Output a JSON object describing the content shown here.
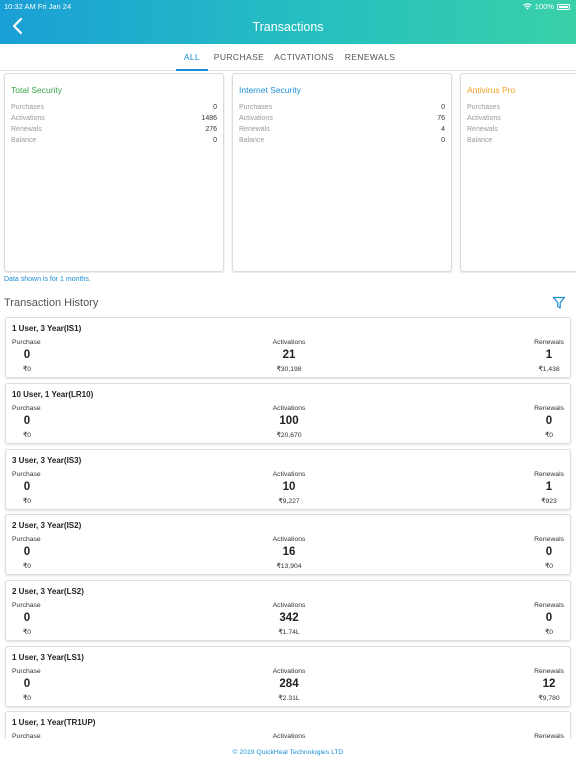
{
  "status": {
    "time": "10:32 AM   Fri Jan 24",
    "battery": "100%"
  },
  "header": {
    "title": "Transactions"
  },
  "tabs": [
    {
      "label": "ALL",
      "active": true
    },
    {
      "label": "PURCHASE",
      "active": false
    },
    {
      "label": "ACTIVATIONS",
      "active": false
    },
    {
      "label": "RENEWALS",
      "active": false
    }
  ],
  "summary_cards": [
    {
      "title": "Total Security",
      "title_color": "#3aa64a",
      "rows": [
        {
          "label": "Purchases",
          "value": "0"
        },
        {
          "label": "Activations",
          "value": "1486"
        },
        {
          "label": "Renewals",
          "value": "276"
        },
        {
          "label": "Balance",
          "value": "0"
        }
      ]
    },
    {
      "title": "Internet Security",
      "title_color": "#1a8fd6",
      "rows": [
        {
          "label": "Purchases",
          "value": "0"
        },
        {
          "label": "Activations",
          "value": "76"
        },
        {
          "label": "Renewals",
          "value": "4"
        },
        {
          "label": "Balance",
          "value": "0"
        }
      ]
    },
    {
      "title": "Antivirus Pro",
      "title_color": "#f0a020",
      "rows": [
        {
          "label": "Purchases",
          "value": ""
        },
        {
          "label": "Activations",
          "value": ""
        },
        {
          "label": "Renewals",
          "value": ""
        },
        {
          "label": "Balance",
          "value": ""
        }
      ]
    }
  ],
  "data_note": "Data shown is for 1 months.",
  "history": {
    "title": "Transaction History",
    "filter_icon": "filter-icon",
    "column_labels": {
      "purchase": "Purchase",
      "activations": "Activations",
      "renewals": "Renewals"
    },
    "items": [
      {
        "name": "1 User, 3 Year(IS1)",
        "purchase": "0",
        "purchase_amt": "₹0",
        "activations": "21",
        "activations_amt": "₹30,198",
        "renewals": "1",
        "renewals_amt": "₹1,438"
      },
      {
        "name": "10 User, 1 Year(LR10)",
        "purchase": "0",
        "purchase_amt": "₹0",
        "activations": "100",
        "activations_amt": "₹20,670",
        "renewals": "0",
        "renewals_amt": "₹0"
      },
      {
        "name": "3 User, 3 Year(IS3)",
        "purchase": "0",
        "purchase_amt": "₹0",
        "activations": "10",
        "activations_amt": "₹9,227",
        "renewals": "1",
        "renewals_amt": "₹923"
      },
      {
        "name": "2 User, 3 Year(IS2)",
        "purchase": "0",
        "purchase_amt": "₹0",
        "activations": "16",
        "activations_amt": "₹13,904",
        "renewals": "0",
        "renewals_amt": "₹0"
      },
      {
        "name": "2 User, 3 Year(LS2)",
        "purchase": "0",
        "purchase_amt": "₹0",
        "activations": "342",
        "activations_amt": "₹1.74L",
        "renewals": "0",
        "renewals_amt": "₹0"
      },
      {
        "name": "1 User, 3 Year(LS1)",
        "purchase": "0",
        "purchase_amt": "₹0",
        "activations": "284",
        "activations_amt": "₹2.31L",
        "renewals": "12",
        "renewals_amt": "₹9,780"
      },
      {
        "name": "1 User, 1 Year(TR1UP)",
        "purchase": "",
        "purchase_amt": "",
        "activations": "",
        "activations_amt": "",
        "renewals": "",
        "renewals_amt": ""
      }
    ]
  },
  "footer": "© 2019 QuickHeal Technologies LTD"
}
